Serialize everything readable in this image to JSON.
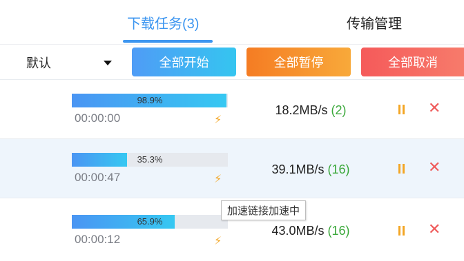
{
  "tabs": {
    "active_label": "下载任务(3)",
    "other_label": "传输管理"
  },
  "toolbar": {
    "sort_value": "默认",
    "start_all_label": "全部开始",
    "pause_all_label": "全部暂停",
    "cancel_all_label": "全部取消"
  },
  "tasks": [
    {
      "progress_text": "98.9%",
      "progress": 0.989,
      "time": "00:00:00",
      "speed": "18.2MB/s",
      "connections": "(2)"
    },
    {
      "progress_text": "35.3%",
      "progress": 0.353,
      "time": "00:00:47",
      "speed": "39.1MB/s",
      "connections": "(16)"
    },
    {
      "progress_text": "65.9%",
      "progress": 0.659,
      "time": "00:00:12",
      "speed": "43.0MB/s",
      "connections": "(16)"
    }
  ],
  "tooltip": {
    "text": "加速链接加速中"
  },
  "icons": {
    "accelerate": "lightning-icon",
    "pause": "pause-icon",
    "cancel": "close-icon",
    "dropdown": "caret-down-icon"
  },
  "colors": {
    "accent": "#3d96f0",
    "pause_accent": "#f3a625",
    "cancel_accent": "#ef5a5a",
    "connections": "#3aa83a"
  }
}
